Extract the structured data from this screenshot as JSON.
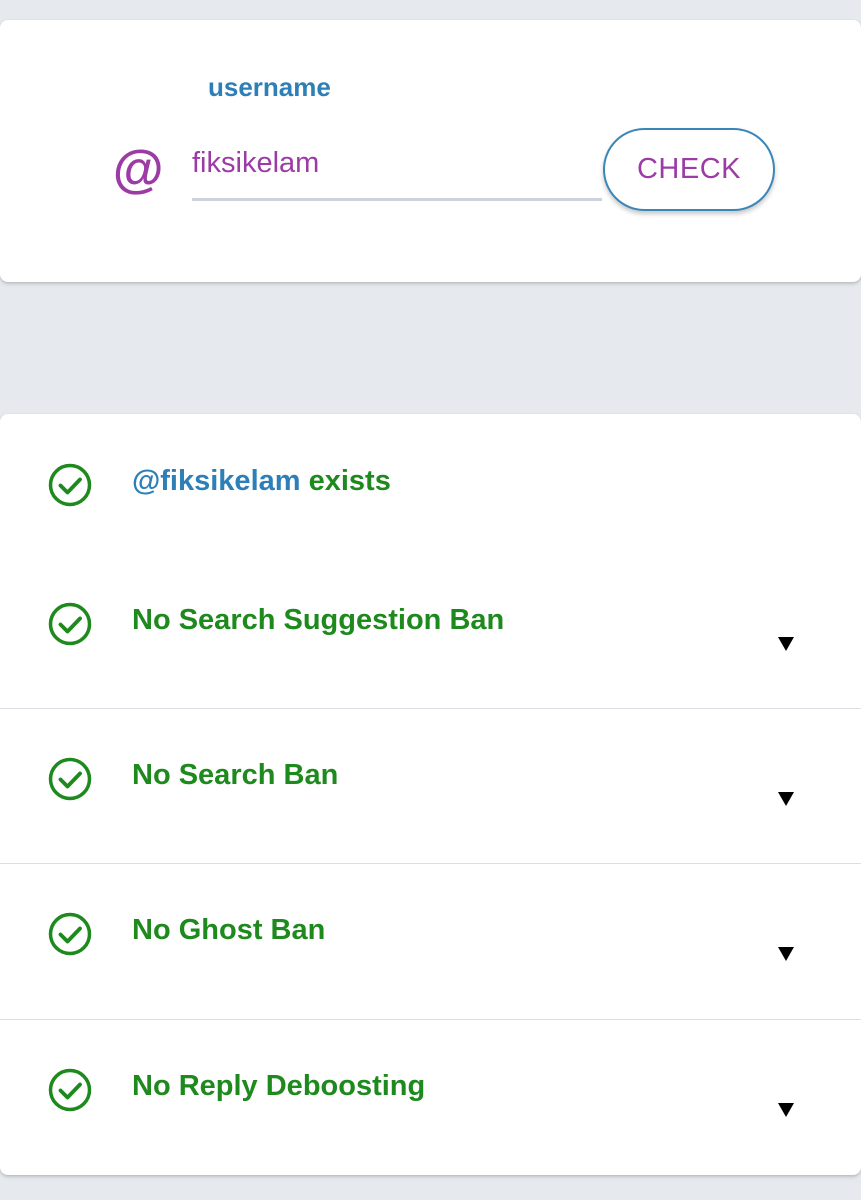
{
  "search": {
    "at_symbol": "@",
    "field_label": "username",
    "input_value": "fiksikelam",
    "button_label": "CHECK"
  },
  "results": {
    "exists": {
      "handle": "@fiksikelam",
      "text": "exists",
      "icon": "check-circle-icon"
    },
    "items": [
      {
        "label": "No Search Suggestion Ban",
        "icon": "check-circle-icon",
        "expand_icon": "triangle-down-icon"
      },
      {
        "label": "No Search Ban",
        "icon": "check-circle-icon",
        "expand_icon": "triangle-down-icon"
      },
      {
        "label": "No Ghost Ban",
        "icon": "check-circle-icon",
        "expand_icon": "triangle-down-icon"
      },
      {
        "label": "No Reply Deboosting",
        "icon": "check-circle-icon",
        "expand_icon": "triangle-down-icon"
      }
    ]
  },
  "colors": {
    "background": "#e6eaee",
    "accent_purple": "#9c3ba6",
    "accent_blue": "#2d7fb7",
    "success_green": "#1e8a1e"
  }
}
